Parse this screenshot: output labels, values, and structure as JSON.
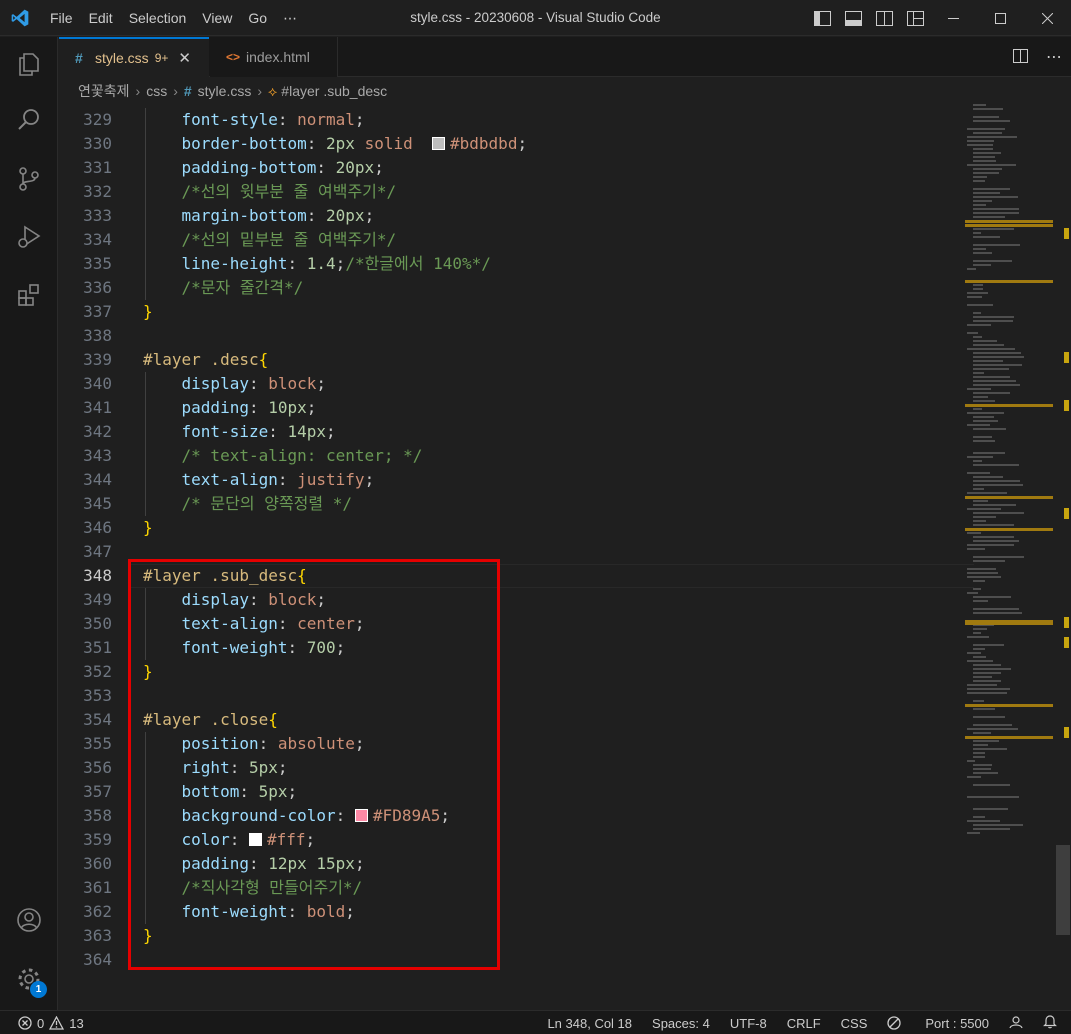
{
  "window": {
    "title": "style.css - 20230608 - Visual Studio Code",
    "menu": [
      "File",
      "Edit",
      "Selection",
      "View",
      "Go",
      "⋯"
    ]
  },
  "tabs": [
    {
      "label": "style.css",
      "count": "9+",
      "icon": "#",
      "active": true
    },
    {
      "label": "index.html",
      "icon": "<>",
      "active": false
    }
  ],
  "breadcrumb": {
    "folder": "연꽃축제",
    "sub": "css",
    "file": "style.css",
    "symbol": "#layer .sub_desc"
  },
  "editor": {
    "current_line": "348",
    "lines": [
      {
        "n": "329",
        "t": [
          [
            "    ",
            "pun"
          ],
          [
            "font-style",
            "prop"
          ],
          [
            ": ",
            "pun"
          ],
          [
            "normal",
            "val"
          ],
          [
            ";",
            "pun"
          ]
        ]
      },
      {
        "n": "330",
        "t": [
          [
            "    ",
            "pun"
          ],
          [
            "border-bottom",
            "prop"
          ],
          [
            ": ",
            "pun"
          ],
          [
            "2px",
            "num"
          ],
          [
            " ",
            "pun"
          ],
          [
            "solid",
            "val"
          ],
          [
            "  ",
            "pun"
          ],
          [
            "SW#bdbdbd",
            "sw"
          ],
          [
            "#bdbdbd",
            "val"
          ],
          [
            ";",
            "pun"
          ]
        ]
      },
      {
        "n": "331",
        "t": [
          [
            "    ",
            "pun"
          ],
          [
            "padding-bottom",
            "prop"
          ],
          [
            ": ",
            "pun"
          ],
          [
            "20px",
            "num"
          ],
          [
            ";",
            "pun"
          ]
        ]
      },
      {
        "n": "332",
        "t": [
          [
            "    ",
            "pun"
          ],
          [
            "/*선의 윗부분 줄 여백주기*/",
            "com"
          ]
        ]
      },
      {
        "n": "333",
        "t": [
          [
            "    ",
            "pun"
          ],
          [
            "margin-bottom",
            "prop"
          ],
          [
            ": ",
            "pun"
          ],
          [
            "20px",
            "num"
          ],
          [
            ";",
            "pun"
          ]
        ]
      },
      {
        "n": "334",
        "t": [
          [
            "    ",
            "pun"
          ],
          [
            "/*선의 밑부분 줄 여백주기*/",
            "com"
          ]
        ]
      },
      {
        "n": "335",
        "t": [
          [
            "    ",
            "pun"
          ],
          [
            "line-height",
            "prop"
          ],
          [
            ": ",
            "pun"
          ],
          [
            "1.4",
            "num"
          ],
          [
            ";",
            "pun"
          ],
          [
            "/*한글에서 140%*/",
            "com"
          ]
        ]
      },
      {
        "n": "336",
        "t": [
          [
            "    ",
            "pun"
          ],
          [
            "/*문자 줄간격*/",
            "com"
          ]
        ]
      },
      {
        "n": "337",
        "t": [
          [
            "}",
            "br"
          ]
        ]
      },
      {
        "n": "338",
        "t": []
      },
      {
        "n": "339",
        "t": [
          [
            "#layer .desc",
            "sel"
          ],
          [
            "{",
            "br"
          ]
        ]
      },
      {
        "n": "340",
        "t": [
          [
            "    ",
            "pun"
          ],
          [
            "display",
            "prop"
          ],
          [
            ": ",
            "pun"
          ],
          [
            "block",
            "val"
          ],
          [
            ";",
            "pun"
          ]
        ]
      },
      {
        "n": "341",
        "t": [
          [
            "    ",
            "pun"
          ],
          [
            "padding",
            "prop"
          ],
          [
            ": ",
            "pun"
          ],
          [
            "10px",
            "num"
          ],
          [
            ";",
            "pun"
          ]
        ]
      },
      {
        "n": "342",
        "t": [
          [
            "    ",
            "pun"
          ],
          [
            "font-size",
            "prop"
          ],
          [
            ": ",
            "pun"
          ],
          [
            "14px",
            "num"
          ],
          [
            ";",
            "pun"
          ]
        ]
      },
      {
        "n": "343",
        "t": [
          [
            "    ",
            "pun"
          ],
          [
            "/* text-align: center; */",
            "com"
          ]
        ]
      },
      {
        "n": "344",
        "t": [
          [
            "    ",
            "pun"
          ],
          [
            "text-align",
            "prop"
          ],
          [
            ": ",
            "pun"
          ],
          [
            "justify",
            "val"
          ],
          [
            ";",
            "pun"
          ]
        ]
      },
      {
        "n": "345",
        "t": [
          [
            "    ",
            "pun"
          ],
          [
            "/* 문단의 양쪽정렬 */",
            "com"
          ]
        ]
      },
      {
        "n": "346",
        "t": [
          [
            "}",
            "br"
          ]
        ]
      },
      {
        "n": "347",
        "t": []
      },
      {
        "n": "348",
        "t": [
          [
            "#layer .sub_desc",
            "sel"
          ],
          [
            "{",
            "br"
          ]
        ]
      },
      {
        "n": "349",
        "t": [
          [
            "    ",
            "pun"
          ],
          [
            "display",
            "prop"
          ],
          [
            ": ",
            "pun"
          ],
          [
            "block",
            "val"
          ],
          [
            ";",
            "pun"
          ]
        ]
      },
      {
        "n": "350",
        "t": [
          [
            "    ",
            "pun"
          ],
          [
            "text-align",
            "prop"
          ],
          [
            ": ",
            "pun"
          ],
          [
            "center",
            "val"
          ],
          [
            ";",
            "pun"
          ]
        ]
      },
      {
        "n": "351",
        "t": [
          [
            "    ",
            "pun"
          ],
          [
            "font-weight",
            "prop"
          ],
          [
            ": ",
            "pun"
          ],
          [
            "700",
            "num"
          ],
          [
            ";",
            "pun"
          ]
        ]
      },
      {
        "n": "352",
        "t": [
          [
            "}",
            "br"
          ]
        ]
      },
      {
        "n": "353",
        "t": []
      },
      {
        "n": "354",
        "t": [
          [
            "#layer .close",
            "sel"
          ],
          [
            "{",
            "br"
          ]
        ]
      },
      {
        "n": "355",
        "t": [
          [
            "    ",
            "pun"
          ],
          [
            "position",
            "prop"
          ],
          [
            ": ",
            "pun"
          ],
          [
            "absolute",
            "val"
          ],
          [
            ";",
            "pun"
          ]
        ]
      },
      {
        "n": "356",
        "t": [
          [
            "    ",
            "pun"
          ],
          [
            "right",
            "prop"
          ],
          [
            ": ",
            "pun"
          ],
          [
            "5px",
            "num"
          ],
          [
            ";",
            "pun"
          ]
        ]
      },
      {
        "n": "357",
        "t": [
          [
            "    ",
            "pun"
          ],
          [
            "bottom",
            "prop"
          ],
          [
            ": ",
            "pun"
          ],
          [
            "5px",
            "num"
          ],
          [
            ";",
            "pun"
          ]
        ]
      },
      {
        "n": "358",
        "t": [
          [
            "    ",
            "pun"
          ],
          [
            "background-color",
            "prop"
          ],
          [
            ": ",
            "pun"
          ],
          [
            "SW#FD89A5",
            "sw"
          ],
          [
            "#FD89A5",
            "val"
          ],
          [
            ";",
            "pun"
          ]
        ]
      },
      {
        "n": "359",
        "t": [
          [
            "    ",
            "pun"
          ],
          [
            "color",
            "prop"
          ],
          [
            ": ",
            "pun"
          ],
          [
            "SW#ffffff",
            "sw"
          ],
          [
            "#fff",
            "val"
          ],
          [
            ";",
            "pun"
          ]
        ]
      },
      {
        "n": "360",
        "t": [
          [
            "    ",
            "pun"
          ],
          [
            "padding",
            "prop"
          ],
          [
            ": ",
            "pun"
          ],
          [
            "12px 15px",
            "num"
          ],
          [
            ";",
            "pun"
          ]
        ]
      },
      {
        "n": "361",
        "t": [
          [
            "    ",
            "pun"
          ],
          [
            "/*직사각형 만들어주기*/",
            "com"
          ]
        ]
      },
      {
        "n": "362",
        "t": [
          [
            "    ",
            "pun"
          ],
          [
            "font-weight",
            "prop"
          ],
          [
            ": ",
            "pun"
          ],
          [
            "bold",
            "val"
          ],
          [
            ";",
            "pun"
          ]
        ]
      },
      {
        "n": "363",
        "t": [
          [
            "}",
            "br"
          ]
        ]
      },
      {
        "n": "364",
        "t": []
      }
    ]
  },
  "status": {
    "errors": "0",
    "warnings": "13",
    "position": "Ln 348, Col 18",
    "spaces": "Spaces: 4",
    "encoding": "UTF-8",
    "eol": "CRLF",
    "language": "CSS",
    "port": "Port : 5500"
  },
  "activity": {
    "settings_badge": "1"
  },
  "colors": {
    "accent": "#0078d4",
    "highlight_box": "#e50000"
  }
}
